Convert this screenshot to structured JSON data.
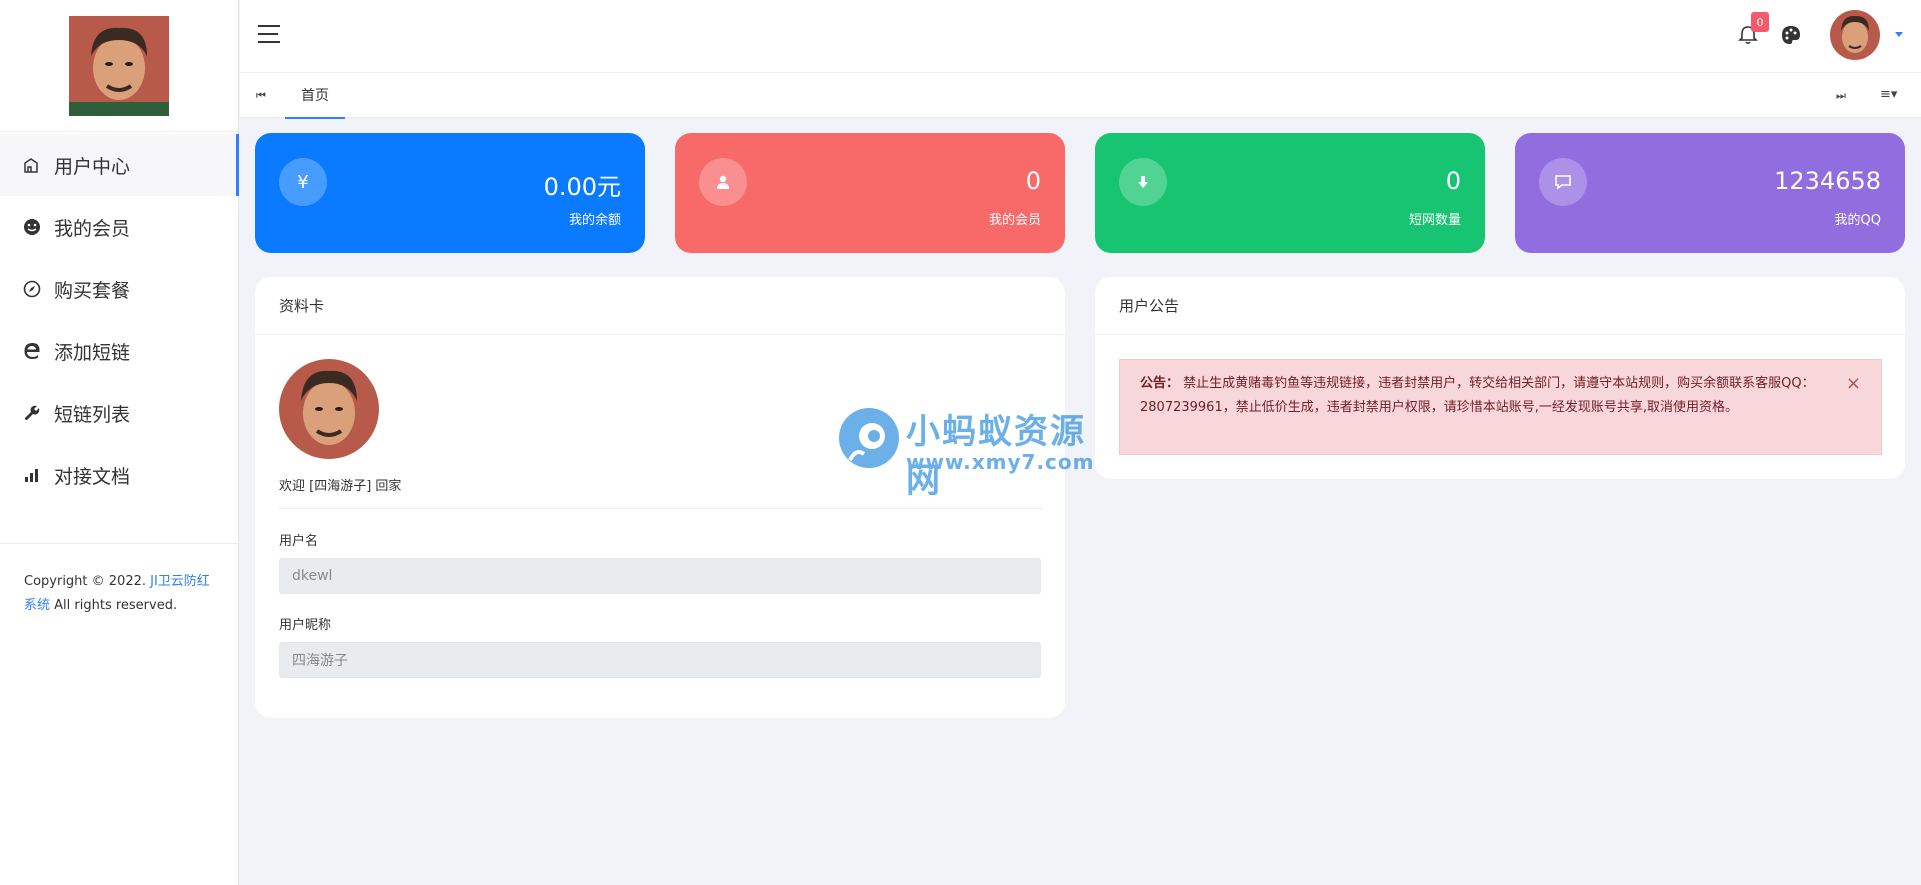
{
  "sidebar": {
    "items": [
      {
        "label": "用户中心",
        "icon": "home-icon",
        "active": true
      },
      {
        "label": "我的会员",
        "icon": "smiley-icon"
      },
      {
        "label": "购买套餐",
        "icon": "compass-icon"
      },
      {
        "label": "添加短链",
        "icon": "edge-icon"
      },
      {
        "label": "短链列表",
        "icon": "wrench-icon"
      },
      {
        "label": "对接文档",
        "icon": "bar-chart-icon"
      }
    ],
    "copyright_prefix": "Copyright © 2022. ",
    "copyright_link": "JI卫云防红系统",
    "copyright_suffix": " All rights reserved."
  },
  "header": {
    "notification_count": "0"
  },
  "tabs": {
    "home": "首页"
  },
  "stats": [
    {
      "value": "0.00元",
      "label": "我的余额",
      "icon": "yen-icon",
      "color": "#0a7bff"
    },
    {
      "value": "0",
      "label": "我的会员",
      "icon": "user-icon",
      "color": "#f86a6a"
    },
    {
      "value": "0",
      "label": "短网数量",
      "icon": "download-icon",
      "color": "#17c471"
    },
    {
      "value": "1234658",
      "label": "我的QQ",
      "icon": "comment-icon",
      "color": "#926de0"
    }
  ],
  "profile": {
    "title": "资料卡",
    "welcome": "欢迎 [四海游子] 回家",
    "username_label": "用户名",
    "username_value": "dkewl",
    "nickname_label": "用户昵称",
    "nickname_value": "四海游子"
  },
  "announcement": {
    "title": "用户公告",
    "prefix": "公告：",
    "text": " 禁止生成黄赌毒钓鱼等违规链接，违者封禁用户，转交给相关部门，请遵守本站规则，购买余额联系客服QQ：2807239961，禁止低价生成，违者封禁用户权限，请珍惜本站账号,一经发现账号共享,取消使用资格。",
    "close": "×"
  },
  "watermark": {
    "title": "小蚂蚁资源网",
    "url": "www.xmy7.com"
  }
}
